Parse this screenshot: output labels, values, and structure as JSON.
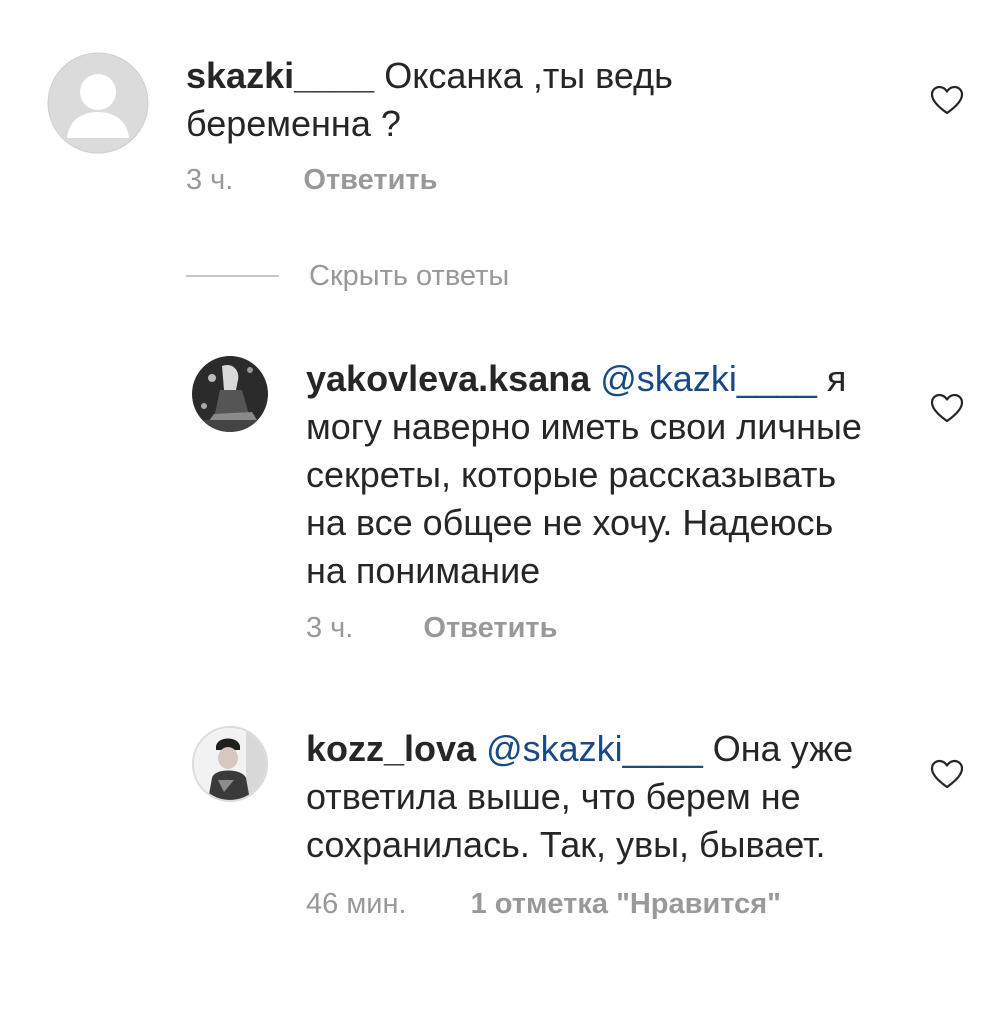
{
  "comments": [
    {
      "username": "skazki____",
      "mention": "",
      "text": " Оксанка ,ты ведь беременна ?",
      "time": "3 ч.",
      "action": "Ответить"
    },
    {
      "username": "yakovleva.ksana",
      "mention": "@skazki____",
      "text": " я могу наверно иметь свои личные секреты, которые рассказывать на все общее не хочу. Надеюсь на понимание",
      "time": "3 ч.",
      "action": "Ответить"
    },
    {
      "username": "kozz_lova",
      "mention": "@skazki____",
      "text": " Она уже ответила выше, что берем не сохранилась. Так, увы, бывает.",
      "time": "46 мин.",
      "action": "1 отметка \"Нравится\""
    }
  ],
  "replies_toggle": {
    "label": "Скрыть ответы"
  },
  "icons": {
    "like": "heart-outline-icon",
    "avatar_default": "default-avatar-icon"
  },
  "colors": {
    "text": "#262626",
    "secondary": "#999999",
    "mention": "#1a4a86",
    "divider": "#c7c7c7"
  }
}
